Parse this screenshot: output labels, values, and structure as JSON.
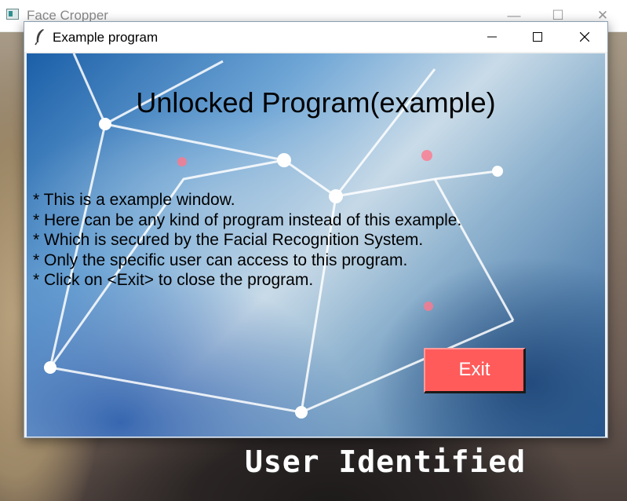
{
  "background_window": {
    "title": "Face Cropper",
    "minimize_glyph": "—",
    "maximize_glyph": "☐",
    "close_glyph": "✕",
    "status_text": "User Identified"
  },
  "window": {
    "title": "Example program",
    "icon": "feather-icon",
    "controls": [
      "minimize-icon",
      "maximize-icon",
      "close-icon"
    ]
  },
  "content": {
    "heading": "Unlocked Program(example)",
    "lines": [
      "* This is a example window.",
      "* Here can be any kind of program instead of this example.",
      "* Which is secured by the Facial Recognition System.",
      "* Only the specific user can access to this program.",
      "* Click on <Exit> to close the program."
    ],
    "exit_label": "Exit"
  },
  "colors": {
    "exit_button": "#ff5b5b",
    "heading_text": "#000000"
  }
}
